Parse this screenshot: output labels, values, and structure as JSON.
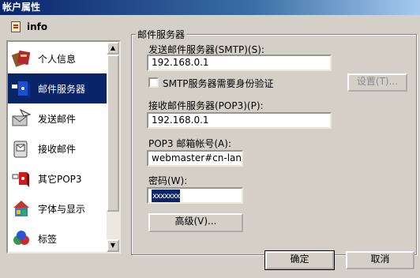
{
  "window": {
    "title": "帐户属性"
  },
  "account": {
    "name": "info"
  },
  "sidebar": {
    "items": [
      {
        "label": "个人信息",
        "icon": "personal-info-icon"
      },
      {
        "label": "邮件服务器",
        "icon": "mail-server-icon",
        "selected": true
      },
      {
        "label": "发送邮件",
        "icon": "send-mail-icon"
      },
      {
        "label": "接收邮件",
        "icon": "receive-mail-icon"
      },
      {
        "label": "其它POP3",
        "icon": "other-pop3-icon"
      },
      {
        "label": "字体与显示",
        "icon": "font-display-icon"
      },
      {
        "label": "标签",
        "icon": "tags-icon"
      }
    ]
  },
  "mail_server": {
    "group_title": "邮件服务器",
    "smtp_label": "发送邮件服务器(SMTP)(S):",
    "smtp_value": "192.168.0.1",
    "smtp_auth_label": "SMTP服务器需要身份验证",
    "smtp_auth_checked": false,
    "settings_button": "设置(T)...",
    "pop3_label": "接收邮件服务器(POP3)(P):",
    "pop3_value": "192.168.0.1",
    "pop3_account_label": "POP3 邮箱帐号(A):",
    "pop3_account_value": "webmaster#cn-lan.com",
    "password_label": "密码(W):",
    "password_value": "xxxxxxx",
    "advanced_button": "高级(V)..."
  },
  "footer": {
    "ok_button": "确定",
    "cancel_button": "取消"
  },
  "colors": {
    "dialog_bg": "#d4d0c8",
    "selection": "#0a246a",
    "title_gradient_start": "#0a246a"
  }
}
